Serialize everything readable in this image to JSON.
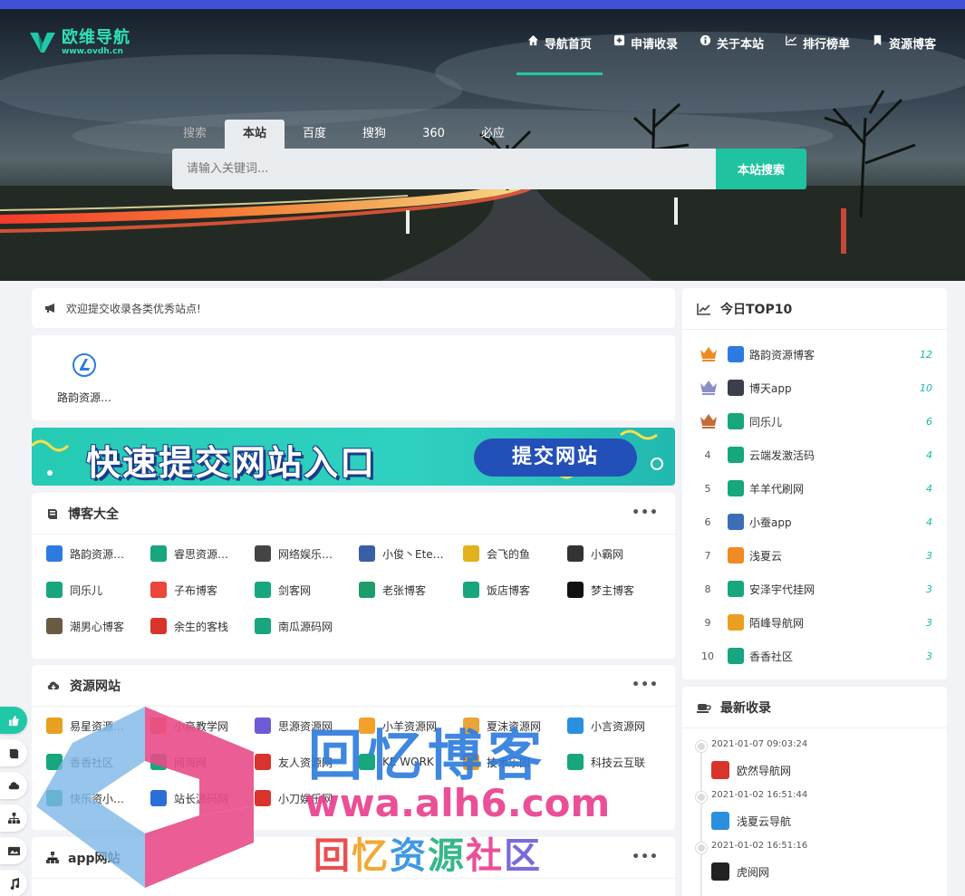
{
  "brand": {
    "title": "欧维导航",
    "subtitle": "www.ovdh.cn"
  },
  "nav": [
    {
      "label": "导航首页",
      "icon": "home-icon",
      "active": true
    },
    {
      "label": "申请收录",
      "icon": "plus-square-icon"
    },
    {
      "label": "关于本站",
      "icon": "info-circle-icon"
    },
    {
      "label": "排行榜单",
      "icon": "line-chart-icon"
    },
    {
      "label": "资源博客",
      "icon": "bookmark-icon"
    }
  ],
  "search": {
    "tabs": [
      "搜索",
      "本站",
      "百度",
      "搜狗",
      "360",
      "必应"
    ],
    "active_tab": "本站",
    "placeholder": "请输入关键词...",
    "button": "本站搜索"
  },
  "notice": {
    "text": "欢迎提交收录各类优秀站点!"
  },
  "featured": {
    "label": "路韵资源…"
  },
  "banner": {
    "text": "快速提交网站入口",
    "button": "提交网站"
  },
  "sections": {
    "blog": {
      "title": "博客大全",
      "more": "•••",
      "items": [
        {
          "label": "路韵资源…",
          "color": "#2d7be0"
        },
        {
          "label": "睿思资源…",
          "color": "#17a67d"
        },
        {
          "label": "网络娱乐…",
          "color": "#444444"
        },
        {
          "label": "小俊丶Ete…",
          "color": "#3a5fa8"
        },
        {
          "label": "会飞的鱼",
          "color": "#e2b11e"
        },
        {
          "label": "小霸网",
          "color": "#333333"
        },
        {
          "label": "同乐儿",
          "color": "#17a67d"
        },
        {
          "label": "子布博客",
          "color": "#e9463c"
        },
        {
          "label": "剑客网",
          "color": "#17a67d"
        },
        {
          "label": "老张博客",
          "color": "#1f9c6b"
        },
        {
          "label": "饭店博客",
          "color": "#17a67d"
        },
        {
          "label": "梦主博客",
          "color": "#111111"
        },
        {
          "label": "潮男心博客",
          "color": "#6a5a44"
        },
        {
          "label": "余生的客栈",
          "color": "#d8342c"
        },
        {
          "label": "南瓜源码网",
          "color": "#17a67d"
        }
      ]
    },
    "resource": {
      "title": "资源网站",
      "more": "•••",
      "items": [
        {
          "label": "易星资源…",
          "color": "#e8a020"
        },
        {
          "label": "小高教学网",
          "color": "#f08a24"
        },
        {
          "label": "思源资源网",
          "color": "#6b5bd6"
        },
        {
          "label": "小羊资源网",
          "color": "#f2a22b"
        },
        {
          "label": "夏沫资源网",
          "color": "#e9a43a"
        },
        {
          "label": "小言资源网",
          "color": "#2b8fe0"
        },
        {
          "label": "香香社区",
          "color": "#17a67d"
        },
        {
          "label": "网海网",
          "color": "#17a67d"
        },
        {
          "label": "友人资源网",
          "color": "#d8342c"
        },
        {
          "label": "KE WORK",
          "color": "#17a67d"
        },
        {
          "label": "技术乐园",
          "color": "#e9a020"
        },
        {
          "label": "科技云互联",
          "color": "#17a67d"
        },
        {
          "label": "快乐资小…",
          "color": "#17a67d"
        },
        {
          "label": "站长源码网",
          "color": "#2b6ed8"
        },
        {
          "label": "小刀娱乐网",
          "color": "#d8342c"
        }
      ]
    },
    "app": {
      "title": "app网站",
      "more": "•••"
    }
  },
  "top10": {
    "title": "今日TOP10",
    "rows": [
      {
        "rank": "1",
        "name": "路韵资源博客",
        "count": "12",
        "color": "#2d7be0"
      },
      {
        "rank": "2",
        "name": "博天app",
        "count": "10",
        "color": "#3a3f4a"
      },
      {
        "rank": "3",
        "name": "同乐儿",
        "count": "6",
        "color": "#17a67d"
      },
      {
        "rank": "4",
        "name": "云端发激活码",
        "count": "4",
        "color": "#17a67d"
      },
      {
        "rank": "5",
        "name": "羊羊代刷网",
        "count": "4",
        "color": "#17a67d"
      },
      {
        "rank": "6",
        "name": "小蚕app",
        "count": "4",
        "color": "#3a6fb8"
      },
      {
        "rank": "7",
        "name": "浅夏云",
        "count": "3",
        "color": "#f08a24"
      },
      {
        "rank": "8",
        "name": "安泽宇代挂网",
        "count": "3",
        "color": "#17a67d"
      },
      {
        "rank": "9",
        "name": "陌峰导航网",
        "count": "3",
        "color": "#e9a020"
      },
      {
        "rank": "10",
        "name": "香香社区",
        "count": "3",
        "color": "#17a67d"
      }
    ]
  },
  "latest": {
    "title": "最新收录",
    "items": [
      {
        "date": "2021-01-07  09:03:24",
        "name": "欧然导航网",
        "color": "#d8342c"
      },
      {
        "date": "2021-01-02  16:51:44",
        "name": "浅夏云导航",
        "color": "#2b8fe0"
      },
      {
        "date": "2021-01-02  16:51:16",
        "name": "虎阅网",
        "color": "#222222"
      }
    ]
  },
  "float_bar": [
    "thumbs-up-icon",
    "book-icon",
    "cloud-download-icon",
    "sitemap-icon",
    "image-icon",
    "music-icon"
  ],
  "watermark": {
    "title": "回忆博客",
    "url": "wwa.alh6.com",
    "sub": [
      "回",
      "忆",
      "资",
      "源",
      "社",
      "区"
    ],
    "sub_colors": [
      "#e83e3e",
      "#f0a020",
      "#2b8fe0",
      "#22b07d",
      "#e83e8c",
      "#6b5bd6"
    ]
  },
  "colors": {
    "accent": "#20c39f",
    "topbar": "#3f51d8"
  }
}
